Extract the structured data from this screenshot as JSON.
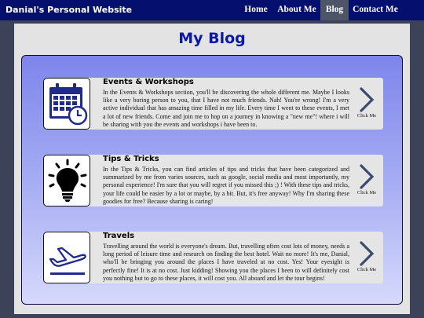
{
  "header": {
    "site_title": "Danial's Personal Website",
    "nav": [
      {
        "label": "Home",
        "active": false
      },
      {
        "label": "About Me",
        "active": false
      },
      {
        "label": "Blog",
        "active": true
      },
      {
        "label": "Contact Me",
        "active": false
      }
    ]
  },
  "main": {
    "title": "My Blog",
    "cards": [
      {
        "title": "Events & Workshops",
        "icon": "calendar-clock-icon",
        "text": "In the Events & Workshops section, you'll be discovering the whole different me. Maybe I looks like a very boring person to you, that I have not much friends. Nah! You're wrong! I'm a very active individual that has amazing time filled in my life. Every time I went to these events, I met a lot of new friends. Come and join me to hop on a journey in knowing a \"new me\"! where i will be sharing with you the events and workshops i have been to.",
        "cta": "Click Me"
      },
      {
        "title": "Tips & Tricks",
        "icon": "lightbulb-icon",
        "text": "In the Tips & Tricks, you can find articles of tips and tricks that have been categorized and summarized by me from varies sources, such as google, social media and most importantly, my personal experience! I'm sure that you will regret if you missed this ;) ! With these tips and tricks, your life could be easier by a lot or maybe, by a bit. But, it's free anyway! Why I'm sharing these goodies for free? Because sharing is caring!",
        "cta": "Click Me"
      },
      {
        "title": "Travels",
        "icon": "airplane-icon",
        "text": "Travelling around the world is everyone's dream. But, travelling often cost lots of money, needs a long period of leisure time and research on finding the best hotel. Wait no more! It's me, Danial, who'll be bringing you around the places I have traveled at no cost. Yes! Your eyesight is perfectly fine! It is at no cost. Just kidding! Showing you the places I been to will definitely cost you nothing but to go to these places, it will cost you. All aboard and let the tour begins!",
        "cta": "Click Me"
      }
    ]
  },
  "colors": {
    "navbar": "#040f6e",
    "active_tab": "#4d5568",
    "title": "#0b18a8",
    "icon": "#1e2a8c"
  }
}
